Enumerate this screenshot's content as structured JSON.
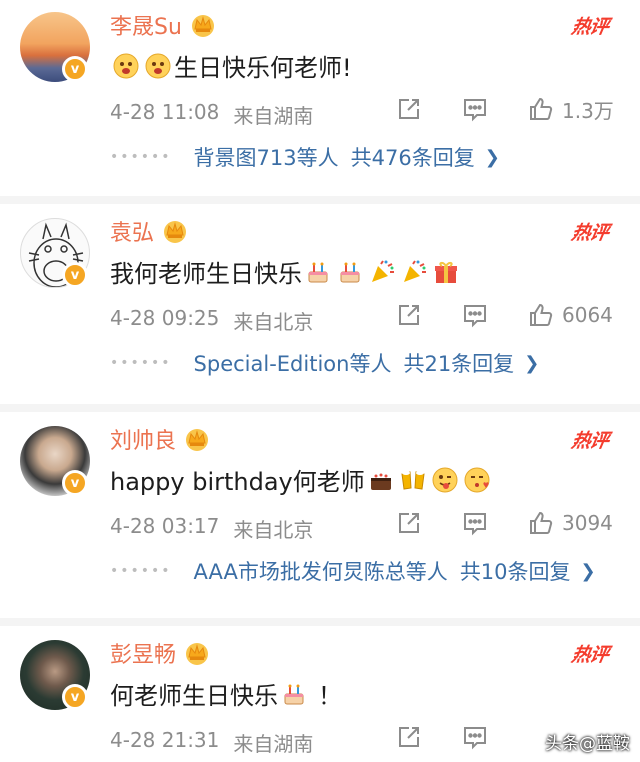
{
  "accent_name_color": "#eb7350",
  "hot_color": "#f43c2d",
  "link_color": "#3b6ea5",
  "comments": [
    {
      "username": "李晟Su",
      "hot_label": "热评",
      "text": "生日快乐何老师!",
      "emoji_before": [
        "face-emoji",
        "face-emoji"
      ],
      "emoji_after": [],
      "date": "4-28 11:08",
      "source": "来自湖南",
      "likes": "1.3万",
      "replies_users": "背景图713等人",
      "replies_count": "共476条回复"
    },
    {
      "username": "袁弘",
      "hot_label": "热评",
      "text": "我何老师生日快乐",
      "emoji_after": [
        "cake-emoji",
        "cake-emoji",
        "party-emoji",
        "party-emoji",
        "gift-emoji"
      ],
      "date": "4-28 09:25",
      "source": "来自北京",
      "likes": "6064",
      "replies_users": "Special-Edition等人",
      "replies_count": "共21条回复"
    },
    {
      "username": "刘帅良",
      "hot_label": "热评",
      "text": "happy birthday何老师",
      "emoji_after": [
        "cake-emoji",
        "cheers-emoji",
        "tongue-emoji",
        "kiss-emoji"
      ],
      "date": "4-28 03:17",
      "source": "来自北京",
      "likes": "3094",
      "replies_users": "AAA市场批发何炅陈总等人",
      "replies_count": "共10条回复"
    },
    {
      "username": "彭昱畅",
      "hot_label": "热评",
      "text_before": "何老师生日快乐",
      "text_after": "！",
      "emoji_after": [
        "cake-emoji"
      ],
      "date": "4-28 21:31",
      "source": "来自湖南"
    }
  ],
  "watermark": "头条@蓝鞍"
}
